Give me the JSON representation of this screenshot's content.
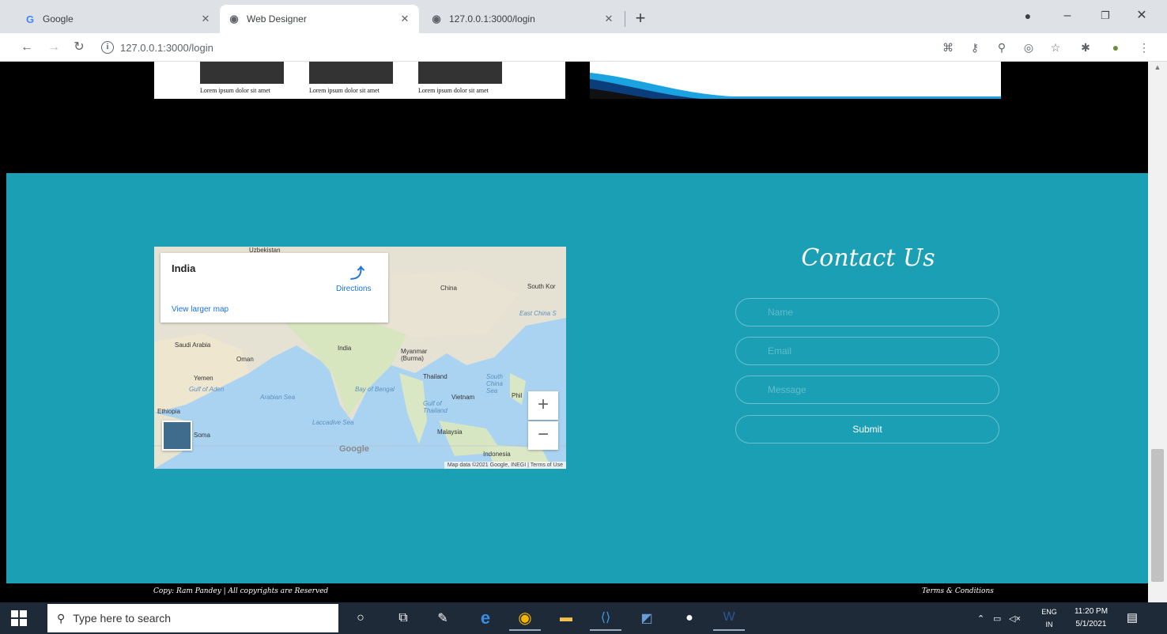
{
  "browser": {
    "tabs": [
      {
        "title": "Google",
        "icon": "google-icon"
      },
      {
        "title": "Web Designer",
        "icon": "globe-icon"
      },
      {
        "title": "127.0.0.1:3000/login",
        "icon": "globe-icon"
      }
    ],
    "url": "127.0.0.1:3000/login"
  },
  "page": {
    "gallery_captions": [
      "Lorem ipsum dolor sit amet",
      "Lorem ipsum dolor sit amet",
      "Lorem ipsum dolor sit amet"
    ],
    "map": {
      "place_name": "India",
      "directions_label": "Directions",
      "view_larger_label": "View larger map",
      "zoom_in": "+",
      "zoom_out": "−",
      "google_logo": "Google",
      "attribution": "Map data ©2021 Google, INEGI",
      "terms": "Terms of Use",
      "labels": {
        "uzbekistan": "Uzbekistan",
        "china": "China",
        "south_korea": "South Kor",
        "east_china_sea": "East China S",
        "saudi_arabia": "Saudi Arabia",
        "oman": "Oman",
        "india": "India",
        "myanmar": "Myanmar (Burma)",
        "yemen": "Yemen",
        "gulf_of_aden": "Gulf of Aden",
        "arabian_sea": "Arabian Sea",
        "bay_of_bengal": "Bay of Bengal",
        "thailand": "Thailand",
        "south_china_sea": "South China Sea",
        "vietnam": "Vietnam",
        "philippines": "Phil",
        "ethiopia": "Ethiopia",
        "somalia": "Soma",
        "laccadive_sea": "Laccadive Sea",
        "gulf_of_thailand": "Gulf of Thailand",
        "malaysia": "Malaysia",
        "indonesia": "Indonesia"
      }
    },
    "contact": {
      "title": "Contact Us",
      "name_placeholder": "Name",
      "email_placeholder": "Email",
      "message_placeholder": "Message",
      "submit_label": "Submit"
    },
    "footer": {
      "copyright": "Copy: Ram Pandey | All copyrights are Reserved",
      "terms": "Terms & Conditions"
    }
  },
  "taskbar": {
    "search_placeholder": "Type here to search",
    "language_line1": "ENG",
    "language_line2": "IN",
    "time": "11:20 PM",
    "date": "5/1/2021"
  }
}
